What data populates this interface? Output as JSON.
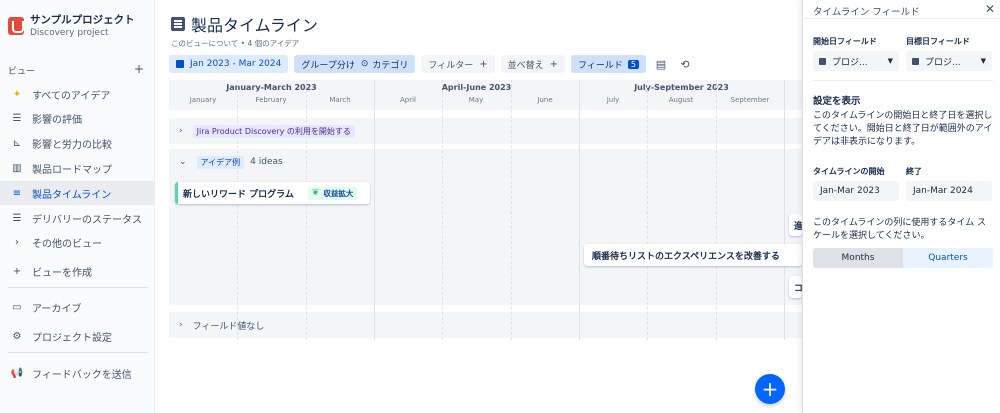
{
  "project": {
    "name": "サンプルプロジェクト",
    "subtitle": "Discovery project"
  },
  "sidebar": {
    "section_title": "ビュー",
    "add": "+",
    "items": [
      {
        "label": "すべてのアイデア",
        "icon": "lightbulb-icon"
      },
      {
        "label": "影響の評価",
        "icon": "list-icon"
      },
      {
        "label": "影響と労力の比較",
        "icon": "matrix-icon"
      },
      {
        "label": "製品ロードマップ",
        "icon": "board-icon"
      },
      {
        "label": "製品タイムライン",
        "icon": "timeline-icon",
        "active": true
      },
      {
        "label": "デリバリーのステータス",
        "icon": "list-icon"
      },
      {
        "label": "その他のビュー",
        "icon": "chevron-right-icon"
      },
      {
        "label": "ビューを作成",
        "icon": "plus-icon"
      }
    ],
    "archive": "アーカイブ",
    "settings": "プロジェクト設定",
    "feedback": "フィードバックを送信"
  },
  "main": {
    "title": "製品タイムライン",
    "about": "このビューについて • 4 個のアイデア",
    "toolbar": {
      "range": "Jan 2023 - Mar 2024",
      "group": "グループ分け",
      "group_value": "カテゴリ",
      "filter": "フィルター",
      "sort": "並べ替え",
      "fields": "フィールド",
      "fields_count": "5"
    },
    "timeline": {
      "quarters": [
        "January-March 2023",
        "April-June 2023",
        "July-September 2023"
      ],
      "months": [
        "January",
        "February",
        "March",
        "April",
        "May",
        "June",
        "July",
        "August",
        "September"
      ],
      "groups": [
        {
          "label": "Jira Product Discovery の利用を開始する"
        },
        {
          "label": "アイデア例",
          "count": "4 ideas"
        },
        {
          "label": "フィールド値なし"
        }
      ],
      "cards": [
        {
          "title": "新しいリワード プログラム",
          "tag": "収益拡大"
        },
        {
          "title": "順番待ちリストのエクスペリエンスを改善する"
        },
        {
          "title": "進"
        },
        {
          "title": "コ"
        }
      ]
    }
  },
  "panel": {
    "title": "タイムライン フィールド",
    "start_field_label": "開始日フィールド",
    "target_field_label": "目標日フィールド",
    "start_field_value": "プロジ...",
    "target_field_value": "プロジ...",
    "display_heading": "設定を表示",
    "display_text": "このタイムラインの開始日と終了日を選択してください。開始日と終了日が範囲外のアイデアは非表示になります。",
    "start_label": "タイムラインの開始",
    "end_label": "終了",
    "start_value": "Jan-Mar 2023",
    "end_value": "Jan-Mar 2024",
    "scale_text": "このタイムラインの列に使用するタイム スケールを選択してください。",
    "scale_options": [
      "Months",
      "Quarters"
    ],
    "scale_selected": "Months"
  }
}
